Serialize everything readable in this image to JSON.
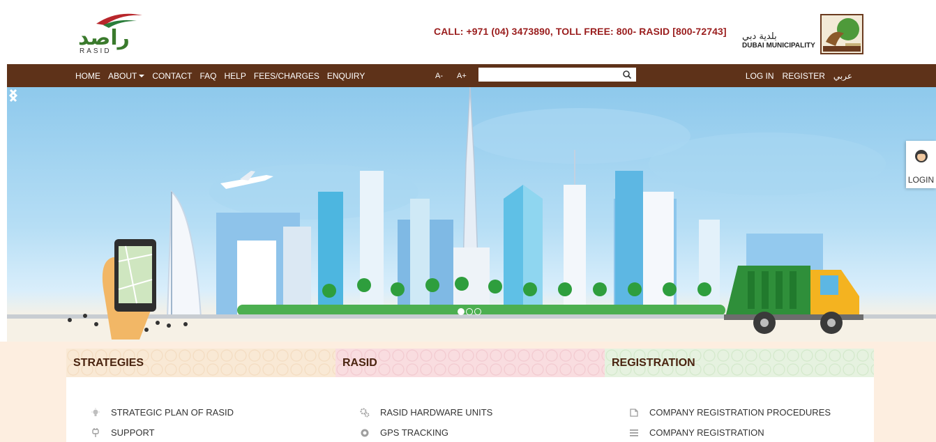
{
  "header": {
    "logo_arabic": "راصد",
    "logo_english": "RASID",
    "contact": "CALL: +971 (04) 3473890, TOLL FREE: 800- RASID [800-72743]",
    "dm_arabic": "بلدية دبي",
    "dm_english": "DUBAI MUNICIPALITY"
  },
  "nav": {
    "items": [
      {
        "label": "HOME"
      },
      {
        "label": "ABOUT"
      },
      {
        "label": "CONTACT"
      },
      {
        "label": "FAQ"
      },
      {
        "label": "HELP"
      },
      {
        "label": "FEES/CHARGES"
      },
      {
        "label": "ENQUIRY"
      }
    ],
    "font_decrease": "A-",
    "font_increase": "A+",
    "search_value": "",
    "login": "LOG IN",
    "register": "REGISTER",
    "arabic": "عربي"
  },
  "hero": {
    "slide_count": 3,
    "active_slide": 1
  },
  "side_login": {
    "label": "LOGIN"
  },
  "sections": [
    {
      "title": "STRATEGIES",
      "items": [
        {
          "label": "STRATEGIC PLAN OF RASID",
          "icon": "lightbulb-icon"
        },
        {
          "label": "SUPPORT",
          "icon": "plug-icon"
        }
      ]
    },
    {
      "title": "RASID",
      "items": [
        {
          "label": "RASID HARDWARE UNITS",
          "icon": "gears-icon"
        },
        {
          "label": "GPS TRACKING",
          "icon": "target-icon"
        }
      ]
    },
    {
      "title": "REGISTRATION",
      "items": [
        {
          "label": "COMPANY REGISTRATION PROCEDURES",
          "icon": "document-icon"
        },
        {
          "label": "COMPANY REGISTRATION",
          "icon": "list-icon"
        }
      ]
    }
  ],
  "colors": {
    "navbar": "#5e3219",
    "contact_text": "#9a1d1d",
    "section_bg": "#fdeee0",
    "heading": "#4a2410"
  }
}
